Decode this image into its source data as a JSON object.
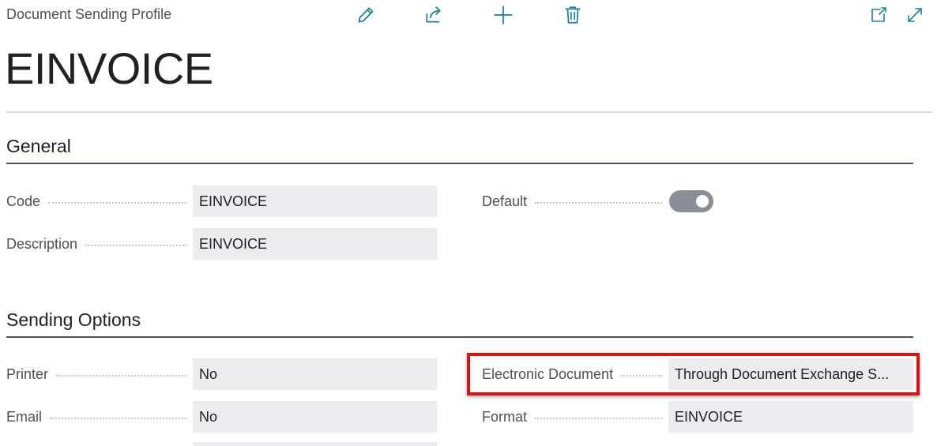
{
  "header": {
    "page_type": "Document Sending Profile",
    "record_title": "EINVOICE",
    "actions": [
      {
        "name": "edit",
        "icon": "pencil-icon"
      },
      {
        "name": "share",
        "icon": "share-icon"
      },
      {
        "name": "new",
        "icon": "plus-icon"
      },
      {
        "name": "delete",
        "icon": "trash-icon"
      }
    ],
    "window_actions": [
      {
        "name": "open-in-new-window",
        "icon": "open-new-window-icon"
      },
      {
        "name": "expand",
        "icon": "expand-icon"
      }
    ]
  },
  "general": {
    "title": "General",
    "code": {
      "label": "Code",
      "value": "EINVOICE"
    },
    "description": {
      "label": "Description",
      "value": "EINVOICE"
    },
    "default": {
      "label": "Default",
      "value": true
    }
  },
  "sending_options": {
    "title": "Sending Options",
    "printer": {
      "label": "Printer",
      "value": "No"
    },
    "email": {
      "label": "Email",
      "value": "No"
    },
    "electronic_document": {
      "label": "Electronic Document",
      "value": "Through Document Exchange S..."
    },
    "format": {
      "label": "Format",
      "value": "EINVOICE"
    }
  },
  "colors": {
    "accent": "#1e8090",
    "highlight": "#e01010",
    "field_bg": "#ececee"
  }
}
